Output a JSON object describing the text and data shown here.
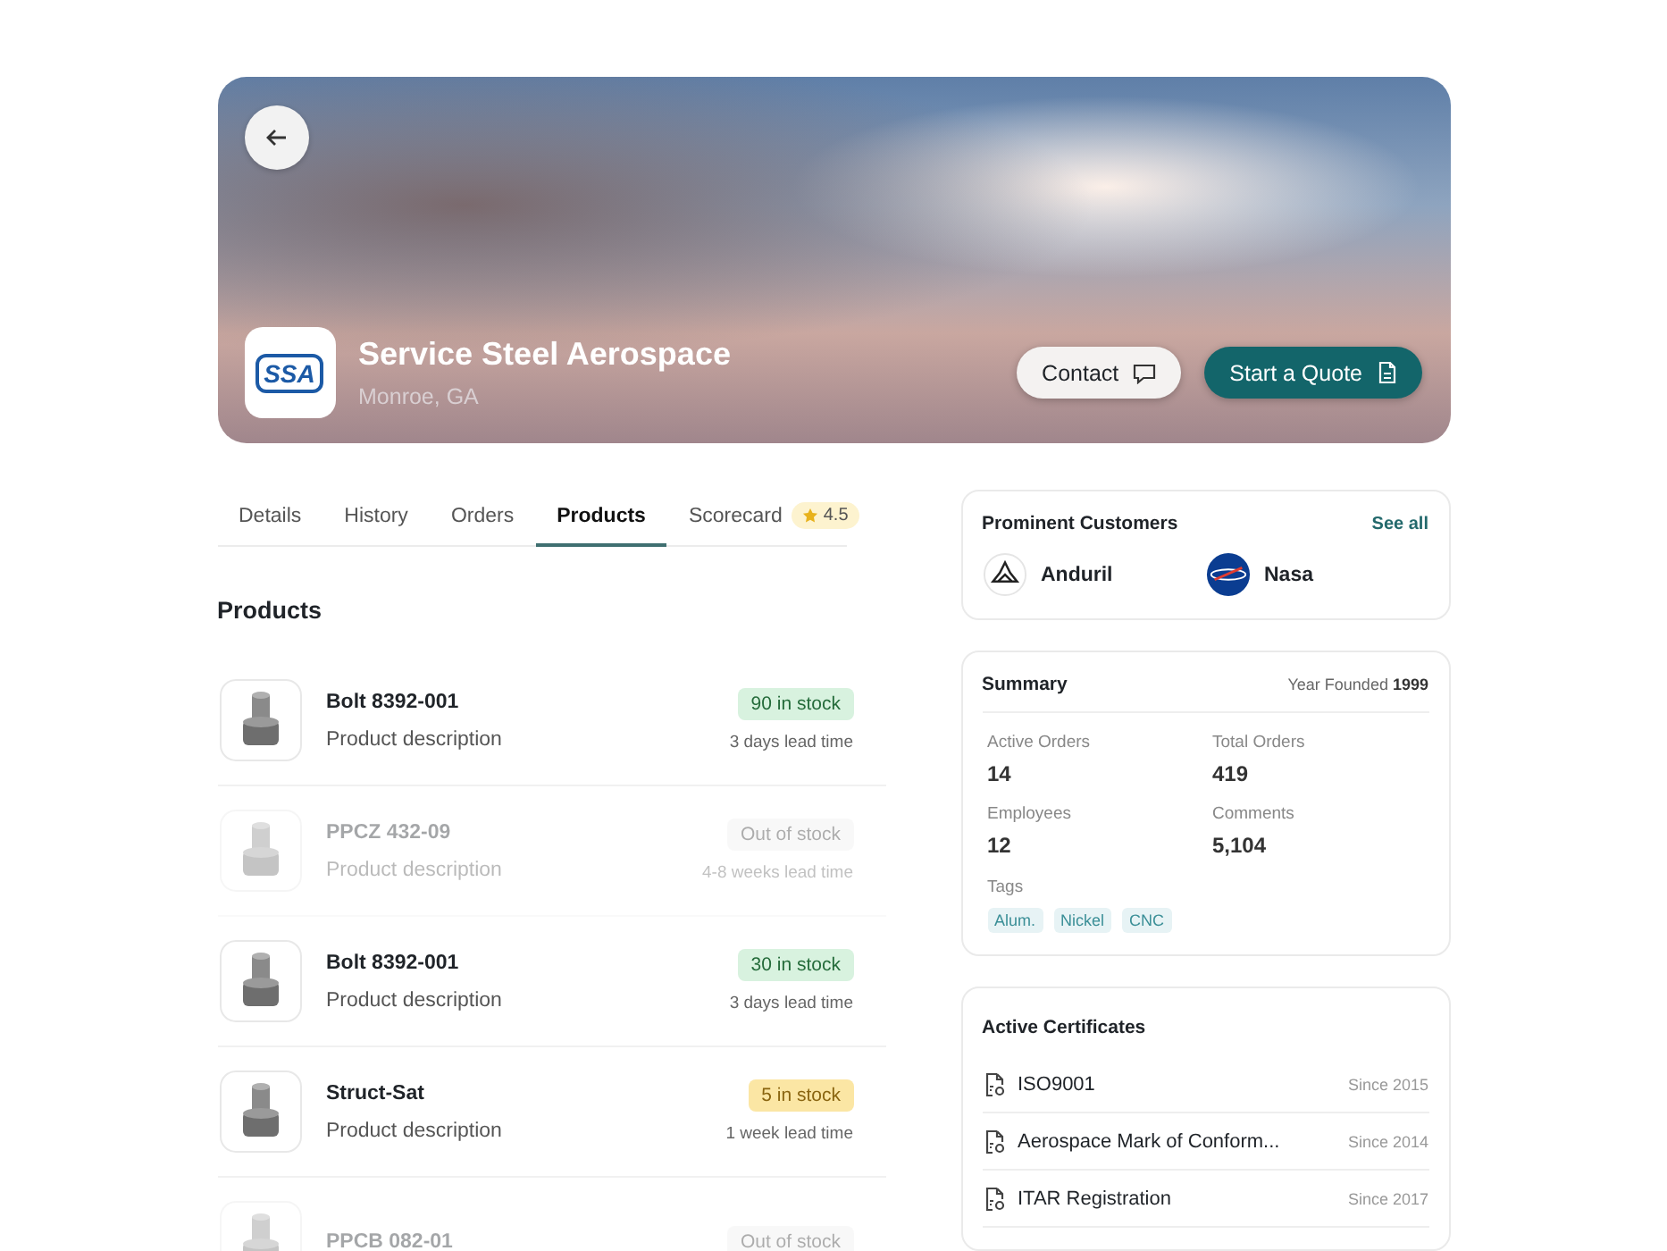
{
  "company": {
    "logo_text": "SSA",
    "name": "Service Steel Aerospace",
    "location": "Monroe, GA"
  },
  "actions": [
    {
      "label": "Contact",
      "kind": "secondary"
    },
    {
      "label": "Start a Quote",
      "kind": "primary"
    }
  ],
  "tabs": [
    {
      "label": "Details",
      "selected": false
    },
    {
      "label": "History",
      "selected": false
    },
    {
      "label": "Orders",
      "selected": false
    },
    {
      "label": "Products",
      "selected": true
    },
    {
      "label": "Scorecard",
      "selected": false,
      "rating": "4.5"
    }
  ],
  "section_title": "Products",
  "products": [
    {
      "name": "Bolt 8392-001",
      "description": "Product description",
      "stock": "90 in stock",
      "kind": "in_stock",
      "lead_time": "3 days lead time",
      "disabled": false
    },
    {
      "name": "PPCZ 432-09",
      "description": "Product description",
      "stock": "Out of stock",
      "kind": "out",
      "lead_time": "4-8 weeks lead time",
      "disabled": true
    },
    {
      "name": "Bolt 8392-001",
      "description": "Product description",
      "stock": "30 in stock",
      "kind": "in_stock",
      "lead_time": "3 days lead time",
      "disabled": false
    },
    {
      "name": "Struct-Sat",
      "description": "Product description",
      "stock": "5 in stock",
      "kind": "low",
      "lead_time": "1 week lead time",
      "disabled": false
    },
    {
      "name": "PPCB 082-01",
      "stock": "Out of stock",
      "kind": "out",
      "disabled": true
    }
  ],
  "customers": {
    "title": "Prominent Customers",
    "link": "See all",
    "items": [
      {
        "name": "Anduril"
      },
      {
        "name": "Nasa"
      }
    ]
  },
  "summary": {
    "title": "Summary",
    "founded_label": "Year Founded",
    "founded": "1999",
    "stats": [
      {
        "label": "Active Orders",
        "value": "14"
      },
      {
        "label": "Total Orders",
        "value": "419"
      },
      {
        "label": "Employees",
        "value": "12"
      },
      {
        "label": "Comments",
        "value": "5,104"
      }
    ],
    "tags_label": "Tags",
    "tags": [
      "Alum.",
      "Nickel",
      "CNC"
    ]
  },
  "certificates": {
    "title": "Active Certificates",
    "items": [
      {
        "name": "ISO9001",
        "since": "Since 2015"
      },
      {
        "name": "Aerospace Mark of Conform...",
        "since": "Since 2014"
      },
      {
        "name": "ITAR Registration",
        "since": "Since 2017"
      }
    ]
  }
}
